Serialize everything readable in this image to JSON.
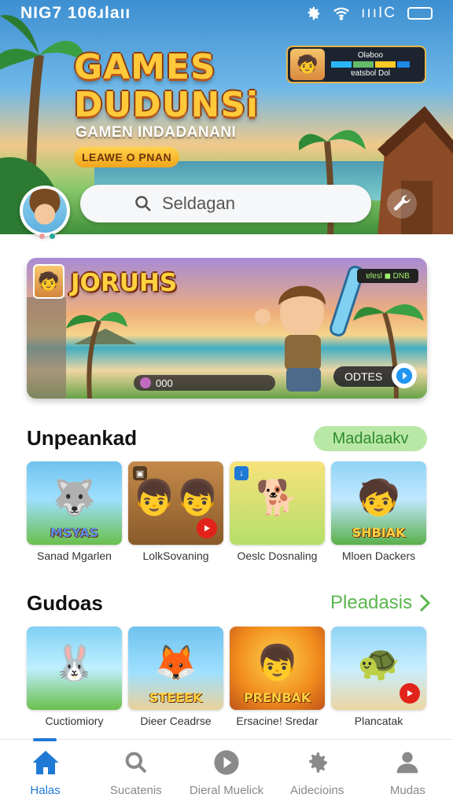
{
  "status_bar": {
    "left_text": "NIG7 106ɹlaıı",
    "right_text": "ıııIC"
  },
  "hero": {
    "title": "GAMES DUDUNSi",
    "subtitle": "GAMEN INDADANANI",
    "pill_label": "LEAWE O PNAN",
    "card_line1": "Oləboo",
    "card_line2": "ɐatsbol Dol"
  },
  "search": {
    "placeholder": "Seldagan"
  },
  "featured": {
    "title": "JORUHS",
    "progress_text": "000",
    "odds_label": "ODTES",
    "badge_text": "ɐlɐsl ◼ DNB"
  },
  "section1": {
    "title": "Unpeankad",
    "action_label": "Madalaakv",
    "games": [
      {
        "label": "Sanad Mgarlen",
        "logo": "MSYAS",
        "icon": "dog-knight-icon"
      },
      {
        "label": "LolkSovaning",
        "logo": "",
        "icon": "kids-play-icon"
      },
      {
        "label": "Oeslc Dosnaling",
        "logo": "",
        "icon": "corgi-icon"
      },
      {
        "label": "Mloen Dackers",
        "logo": "SHBIAK",
        "icon": "hero-boy-icon"
      }
    ]
  },
  "section2": {
    "title": "Gudoas",
    "action_label": "Pleadasis",
    "games": [
      {
        "label": "Cuctiomiory",
        "logo": "",
        "icon": "bunny-warrior-icon"
      },
      {
        "label": "Dieer Ceadrse",
        "logo": "STEEEK",
        "icon": "fox-icon"
      },
      {
        "label": "Ersacine! Sredar",
        "logo": "PRENBAK",
        "icon": "boy-sword-icon"
      },
      {
        "label": "Plancatak",
        "logo": "",
        "icon": "turtle-icon"
      }
    ]
  },
  "nav": [
    {
      "label": "Halas",
      "icon": "home-icon",
      "active": true
    },
    {
      "label": "Sucatenis",
      "icon": "search-icon",
      "active": false
    },
    {
      "label": "Dieral Muelick",
      "icon": "play-circle-icon",
      "active": false
    },
    {
      "label": "Aidecioins",
      "icon": "gear-icon",
      "active": false
    },
    {
      "label": "Mudas",
      "icon": "person-icon",
      "active": false
    }
  ],
  "colors": {
    "accent": "#1f7ad6",
    "green_action": "#5ab64e",
    "title_gold": "#ffc93a"
  }
}
